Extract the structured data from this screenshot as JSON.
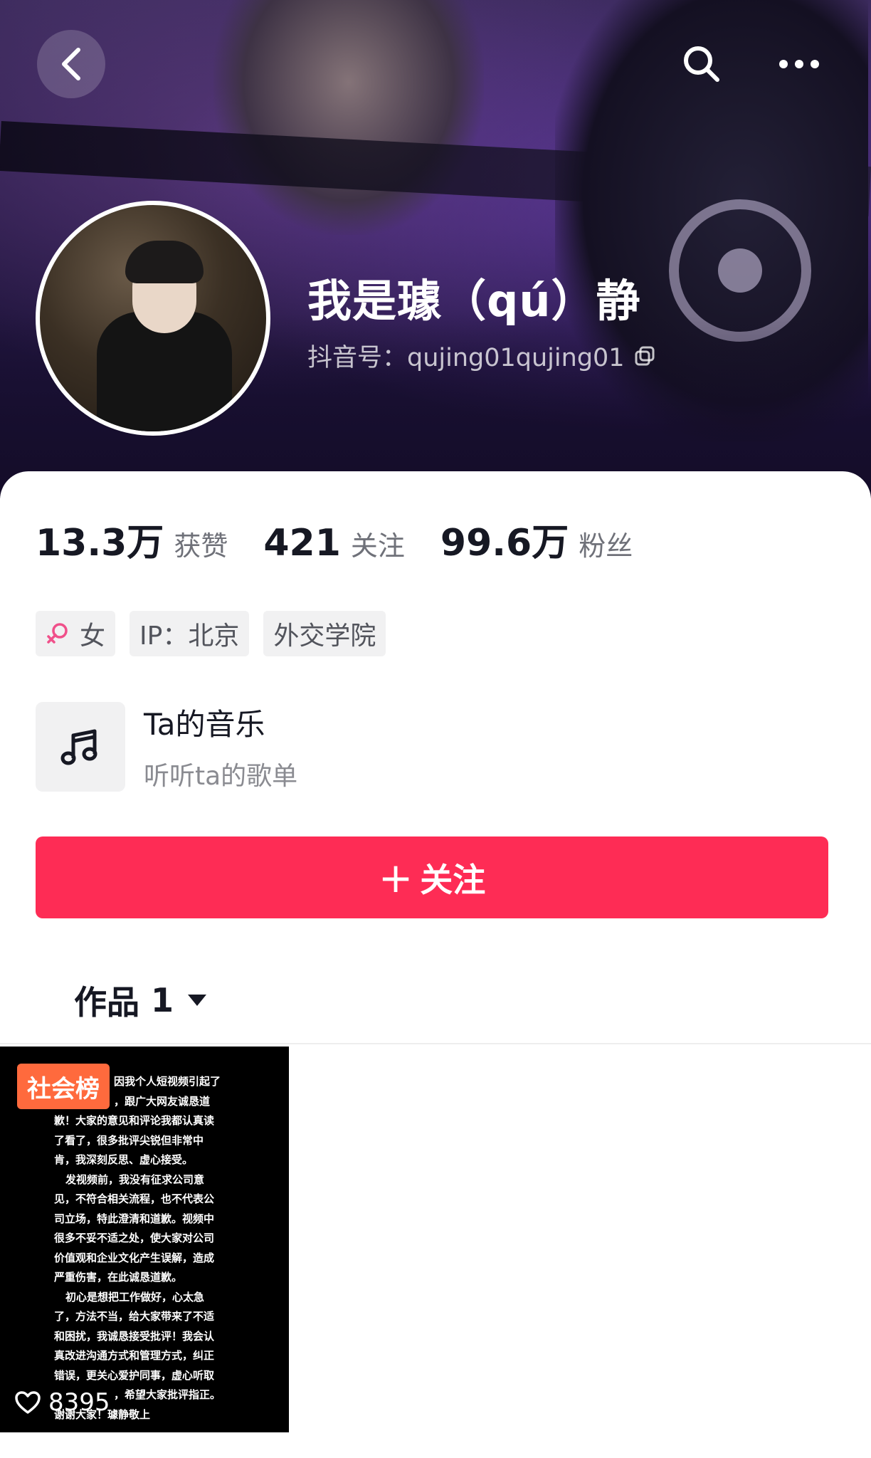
{
  "header": {
    "back_icon": "chevron-left-icon",
    "search_icon": "search-icon",
    "more_icon": "more-dots-icon"
  },
  "profile": {
    "name": "我是璩（qú）静",
    "douyin_id": "抖音号：qujing01qujing01",
    "copy_icon": "copy-icon"
  },
  "stats": [
    {
      "num": "13.3万",
      "label": "获赞"
    },
    {
      "num": "421",
      "label": "关注"
    },
    {
      "num": "99.6万",
      "label": "粉丝"
    }
  ],
  "tags": {
    "gender": "女",
    "gender_icon": "female-icon",
    "gender_color": "#f0508a",
    "ip": "IP：北京",
    "school": "外交学院"
  },
  "music": {
    "icon": "music-note-icon",
    "title": "Ta的音乐",
    "subtitle": "听听ta的歌单"
  },
  "follow_button": {
    "plus": "+",
    "label": "关注",
    "color": "#fe2c55"
  },
  "works_tab": {
    "label": "作品",
    "count": "1",
    "caret_icon": "caret-down-icon"
  },
  "video": {
    "badge": "社会榜",
    "badge_color": "#ff6a3d",
    "lines": [
      "因我个人短视频引起了",
      "，跟广大网友诚恳道",
      "歉！大家的意见和评论我都认真读",
      "了看了，很多批评尖锐但非常中",
      "肯，我深刻反思、虚心接受。",
      "发视频前，我没有征求公司意",
      "见，不符合相关流程，也不代表公",
      "司立场，特此澄清和道歉。视频中",
      "很多不妥不适之处，使大家对公司",
      "价值观和企业文化产生误解，造成",
      "严重伤害，在此诚恳道歉。",
      "初心是想把工作做好，心太急",
      "了，方法不当，给大家带来了不适",
      "和困扰，我诚恳接受批评！我会认",
      "真改进沟通方式和管理方式，纠正",
      "错误，更关心爱护同事，虚心听取",
      "，希望大家批评指正。",
      "谢谢大家！璩静敬上"
    ],
    "likes": "8395",
    "heart_icon": "heart-outline-icon"
  }
}
